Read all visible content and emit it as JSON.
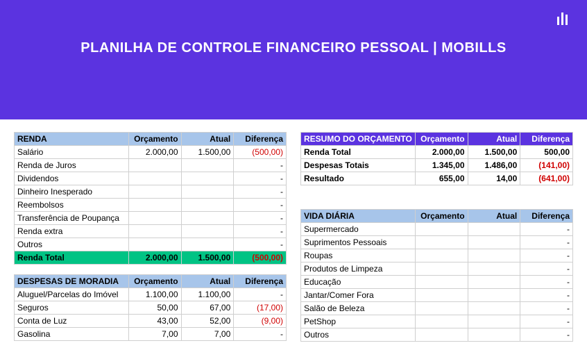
{
  "banner": {
    "title": "PLANILHA DE CONTROLE FINANCEIRO PESSOAL | MOBILLS"
  },
  "headers": {
    "orcamento": "Orçamento",
    "atual": "Atual",
    "diferenca": "Diferença"
  },
  "renda": {
    "title": "RENDA",
    "rows": [
      {
        "label": "Salário",
        "orc": "2.000,00",
        "atual": "1.500,00",
        "dif": "(500,00)",
        "neg": true
      },
      {
        "label": "Renda de Juros",
        "orc": "",
        "atual": "",
        "dif": "-",
        "neg": false
      },
      {
        "label": "Dividendos",
        "orc": "",
        "atual": "",
        "dif": "-",
        "neg": false
      },
      {
        "label": "Dinheiro Inesperado",
        "orc": "",
        "atual": "",
        "dif": "-",
        "neg": false
      },
      {
        "label": "Reembolsos",
        "orc": "",
        "atual": "",
        "dif": "-",
        "neg": false
      },
      {
        "label": "Transferência de Poupança",
        "orc": "",
        "atual": "",
        "dif": "-",
        "neg": false
      },
      {
        "label": "Renda extra",
        "orc": "",
        "atual": "",
        "dif": "-",
        "neg": false
      },
      {
        "label": "Outros",
        "orc": "",
        "atual": "",
        "dif": "-",
        "neg": false
      }
    ],
    "total": {
      "label": "Renda Total",
      "orc": "2.000,00",
      "atual": "1.500,00",
      "dif": "(500,00)"
    }
  },
  "moradia": {
    "title": "DESPESAS DE MORADIA",
    "rows": [
      {
        "label": "Aluguel/Parcelas do Imóvel",
        "orc": "1.100,00",
        "atual": "1.100,00",
        "dif": "-",
        "neg": false
      },
      {
        "label": "Seguros",
        "orc": "50,00",
        "atual": "67,00",
        "dif": "(17,00)",
        "neg": true
      },
      {
        "label": "Conta de Luz",
        "orc": "43,00",
        "atual": "52,00",
        "dif": "(9,00)",
        "neg": true
      },
      {
        "label": "Gasolina",
        "orc": "7,00",
        "atual": "7,00",
        "dif": "-",
        "neg": false
      }
    ]
  },
  "resumo": {
    "title": "RESUMO DO ORÇAMENTO",
    "rows": [
      {
        "label": "Renda Total",
        "orc": "2.000,00",
        "atual": "1.500,00",
        "dif": "500,00",
        "neg": false
      },
      {
        "label": "Despesas Totais",
        "orc": "1.345,00",
        "atual": "1.486,00",
        "dif": "(141,00)",
        "neg": true
      },
      {
        "label": "Resultado",
        "orc": "655,00",
        "atual": "14,00",
        "dif": "(641,00)",
        "neg": true
      }
    ]
  },
  "vida": {
    "title": "VIDA DIÁRIA",
    "rows": [
      {
        "label": "Supermercado",
        "orc": "",
        "atual": "",
        "dif": "-",
        "neg": false
      },
      {
        "label": "Suprimentos Pessoais",
        "orc": "",
        "atual": "",
        "dif": "-",
        "neg": false
      },
      {
        "label": "Roupas",
        "orc": "",
        "atual": "",
        "dif": "-",
        "neg": false
      },
      {
        "label": "Produtos de Limpeza",
        "orc": "",
        "atual": "",
        "dif": "-",
        "neg": false
      },
      {
        "label": "Educação",
        "orc": "",
        "atual": "",
        "dif": "-",
        "neg": false
      },
      {
        "label": "Jantar/Comer Fora",
        "orc": "",
        "atual": "",
        "dif": "-",
        "neg": false
      },
      {
        "label": "Salão de Beleza",
        "orc": "",
        "atual": "",
        "dif": "-",
        "neg": false
      },
      {
        "label": "PetShop",
        "orc": "",
        "atual": "",
        "dif": "-",
        "neg": false
      },
      {
        "label": "Outros",
        "orc": "",
        "atual": "",
        "dif": "-",
        "neg": false
      }
    ]
  },
  "chart_data": [
    {
      "type": "table",
      "title": "RENDA",
      "columns": [
        "Orçamento",
        "Atual",
        "Diferença"
      ],
      "rows": [
        [
          "Salário",
          2000.0,
          1500.0,
          -500.0
        ],
        [
          "Renda de Juros",
          null,
          null,
          null
        ],
        [
          "Dividendos",
          null,
          null,
          null
        ],
        [
          "Dinheiro Inesperado",
          null,
          null,
          null
        ],
        [
          "Reembolsos",
          null,
          null,
          null
        ],
        [
          "Transferência de Poupança",
          null,
          null,
          null
        ],
        [
          "Renda extra",
          null,
          null,
          null
        ],
        [
          "Outros",
          null,
          null,
          null
        ],
        [
          "Renda Total",
          2000.0,
          1500.0,
          -500.0
        ]
      ]
    },
    {
      "type": "table",
      "title": "DESPESAS DE MORADIA",
      "columns": [
        "Orçamento",
        "Atual",
        "Diferença"
      ],
      "rows": [
        [
          "Aluguel/Parcelas do Imóvel",
          1100.0,
          1100.0,
          0
        ],
        [
          "Seguros",
          50.0,
          67.0,
          -17.0
        ],
        [
          "Conta de Luz",
          43.0,
          52.0,
          -9.0
        ],
        [
          "Gasolina",
          7.0,
          7.0,
          0
        ]
      ]
    },
    {
      "type": "table",
      "title": "RESUMO DO ORÇAMENTO",
      "columns": [
        "Orçamento",
        "Atual",
        "Diferença"
      ],
      "rows": [
        [
          "Renda Total",
          2000.0,
          1500.0,
          500.0
        ],
        [
          "Despesas Totais",
          1345.0,
          1486.0,
          -141.0
        ],
        [
          "Resultado",
          655.0,
          14.0,
          -641.0
        ]
      ]
    },
    {
      "type": "table",
      "title": "VIDA DIÁRIA",
      "columns": [
        "Orçamento",
        "Atual",
        "Diferença"
      ],
      "rows": [
        [
          "Supermercado",
          null,
          null,
          null
        ],
        [
          "Suprimentos Pessoais",
          null,
          null,
          null
        ],
        [
          "Roupas",
          null,
          null,
          null
        ],
        [
          "Produtos de Limpeza",
          null,
          null,
          null
        ],
        [
          "Educação",
          null,
          null,
          null
        ],
        [
          "Jantar/Comer Fora",
          null,
          null,
          null
        ],
        [
          "Salão de Beleza",
          null,
          null,
          null
        ],
        [
          "PetShop",
          null,
          null,
          null
        ],
        [
          "Outros",
          null,
          null,
          null
        ]
      ]
    }
  ]
}
